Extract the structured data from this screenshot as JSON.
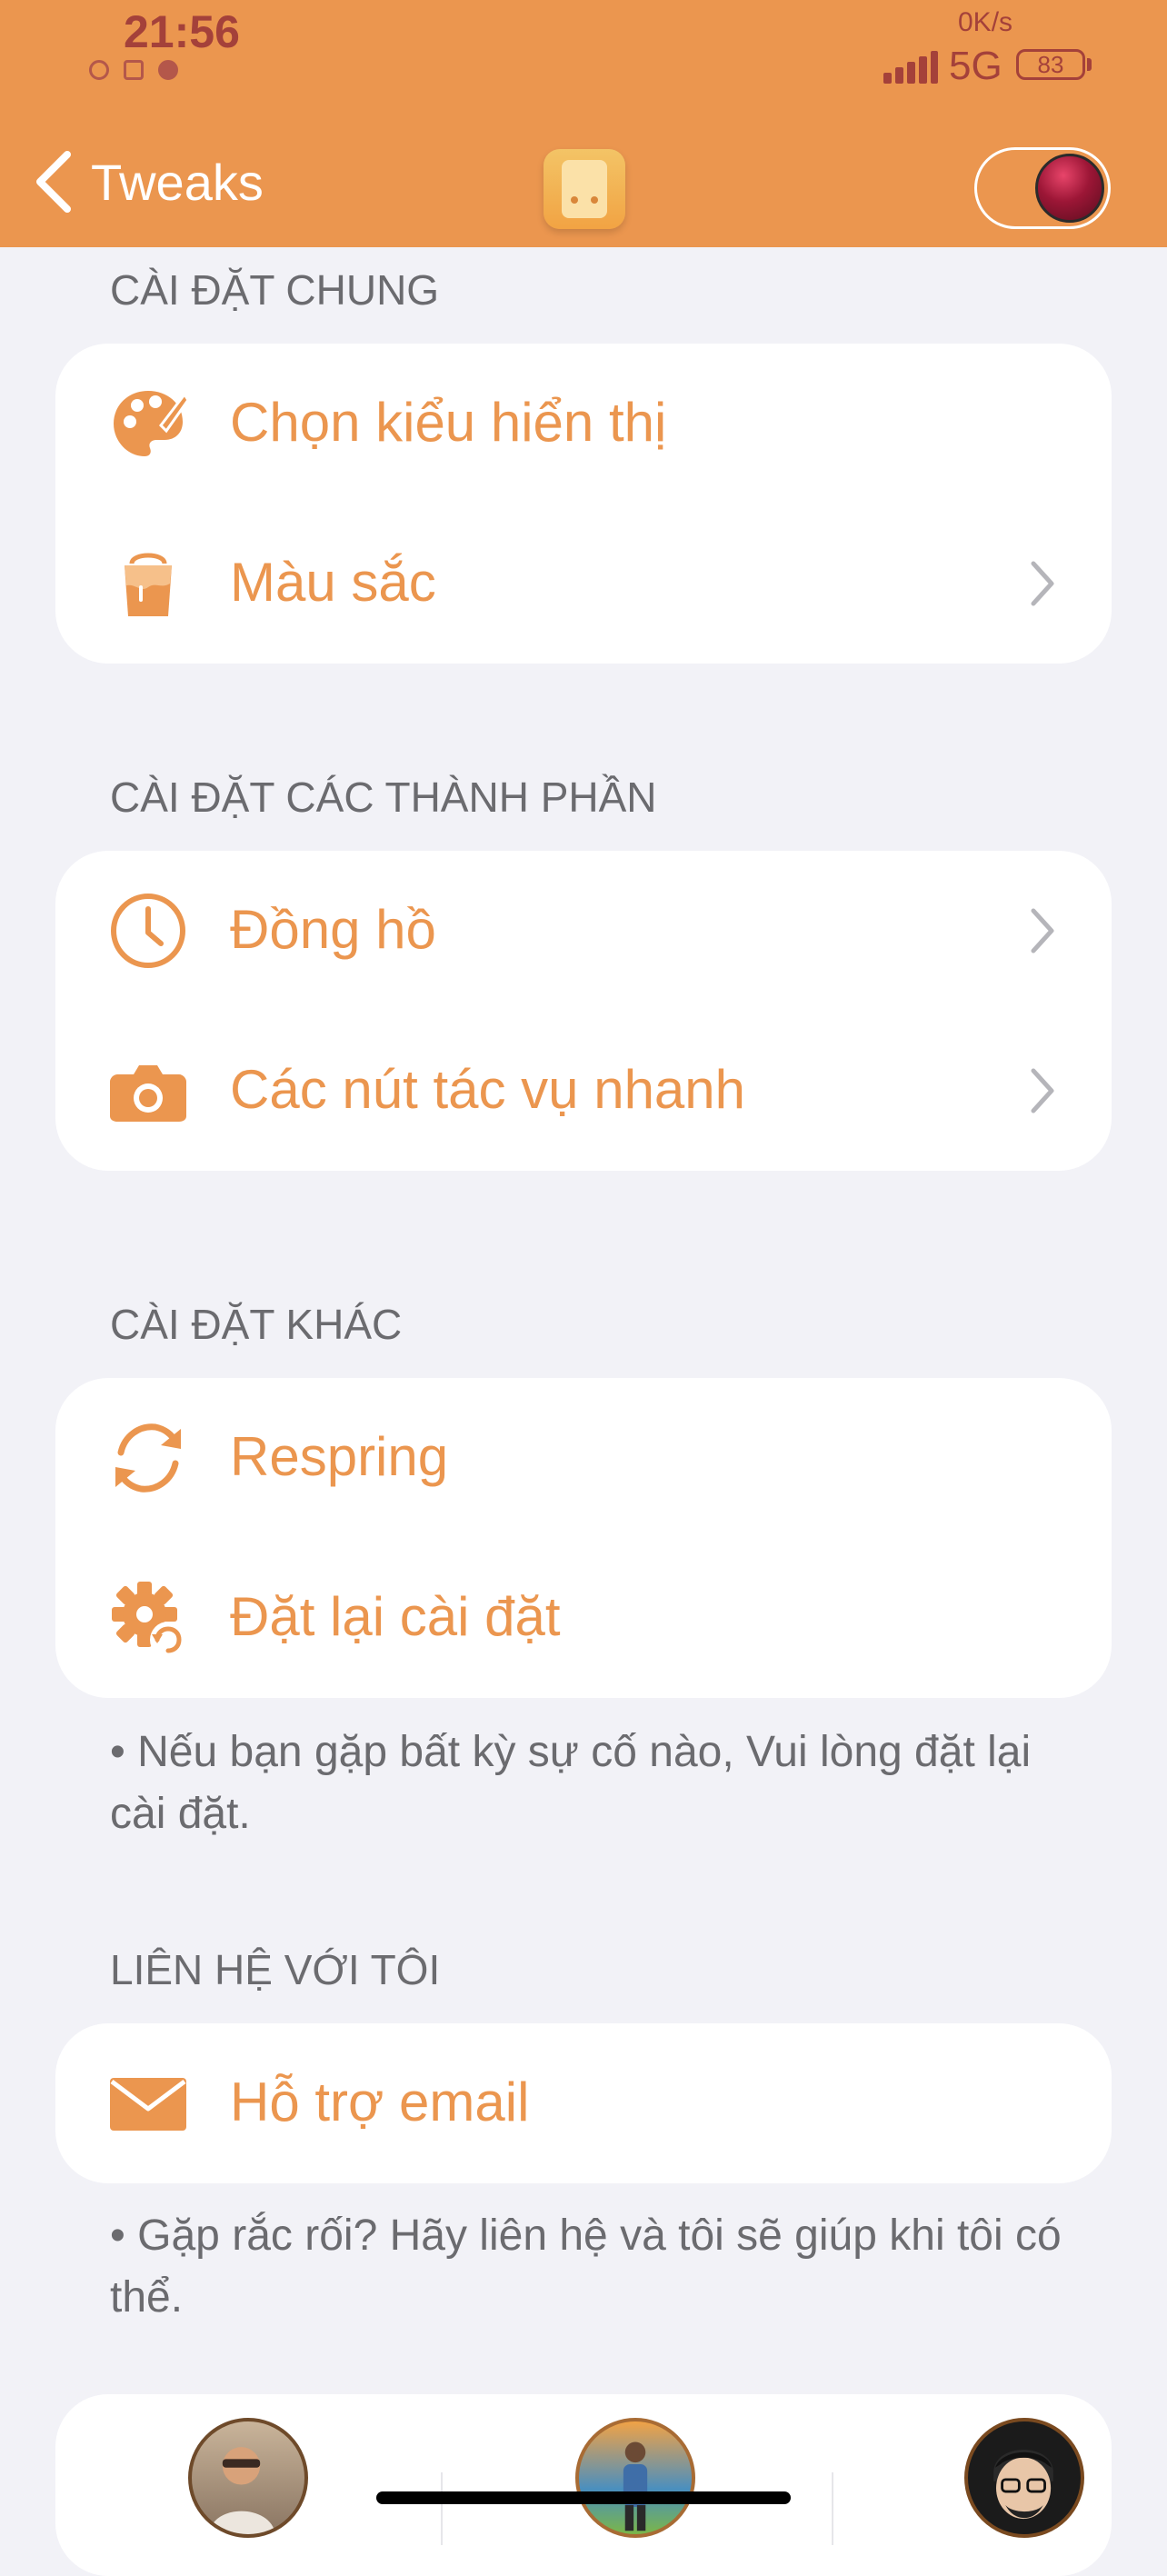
{
  "status_bar": {
    "time": "21:56",
    "speed": "0K/s",
    "network": "5G",
    "battery": "83"
  },
  "nav": {
    "back_label": "Tweaks",
    "toggle_on": true
  },
  "sections": [
    {
      "title": "CÀI ĐẶT CHUNG",
      "items": [
        {
          "label": "Chọn kiểu hiển thị",
          "icon": "palette-icon",
          "chevron": false
        },
        {
          "label": "Màu sắc",
          "icon": "paint-bucket-icon",
          "chevron": true
        }
      ]
    },
    {
      "title": "CÀI ĐẶT CÁC THÀNH PHẦN",
      "items": [
        {
          "label": "Đồng hồ",
          "icon": "clock-icon",
          "chevron": true
        },
        {
          "label": "Các nút tác vụ nhanh",
          "icon": "camera-icon",
          "chevron": true
        }
      ]
    },
    {
      "title": "CÀI ĐẶT KHÁC",
      "items": [
        {
          "label": "Respring",
          "icon": "refresh-icon",
          "chevron": false
        },
        {
          "label": "Đặt lại cài đặt",
          "icon": "gear-reset-icon",
          "chevron": false
        }
      ],
      "footer": "• Nếu bạn gặp bất kỳ sự cố nào, Vui lòng đặt lại cài đặt."
    },
    {
      "title": "LIÊN HỆ VỚI TÔI",
      "items": [
        {
          "label": "Hỗ trợ email",
          "icon": "mail-icon",
          "chevron": false
        }
      ],
      "footer": "• Gặp rắc rối? Hãy liên hệ và tôi sẽ giúp khi tôi có thể."
    }
  ],
  "colors": {
    "accent": "#eb964f",
    "status_text": "#a4413a",
    "background": "#f2f2f7",
    "section_text": "#6b6b6f"
  }
}
